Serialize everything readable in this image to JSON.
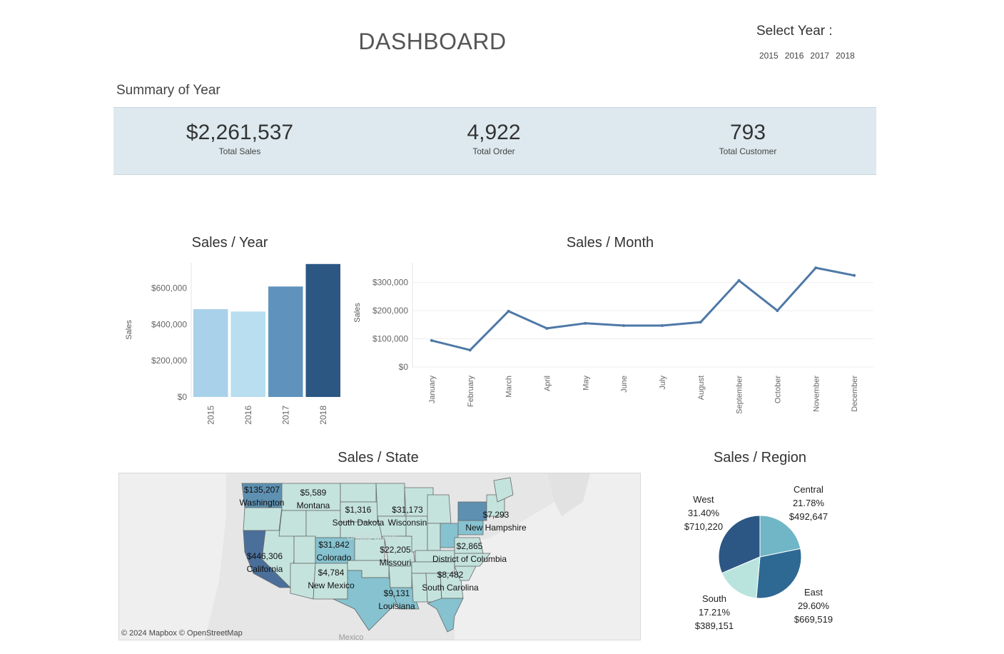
{
  "header": {
    "title": "DASHBOARD",
    "select_year_label": "Select Year :",
    "years": [
      "2015",
      "2016",
      "2017",
      "2018"
    ]
  },
  "summary": {
    "label": "Summary of Year",
    "kpis": [
      {
        "value": "$2,261,537",
        "label": "Total Sales"
      },
      {
        "value": "4,922",
        "label": "Total Order"
      },
      {
        "value": "793",
        "label": "Total Customer"
      }
    ]
  },
  "colors": {
    "kpi_band": "#dde9ef",
    "bar_2015": "#a9d1ea",
    "bar_2016": "#b8def0",
    "bar_2017": "#5f93be",
    "bar_2018": "#2b5782",
    "line": "#4e79a7",
    "map_light": "#c5e3dd",
    "map_mid": "#86c2cf",
    "map_dark": "#4a6f9a"
  },
  "chart_data": [
    {
      "type": "bar",
      "title": "Sales / Year",
      "xlabel": "",
      "ylabel": "Sales",
      "categories": [
        "2015",
        "2016",
        "2017",
        "2018"
      ],
      "values": [
        484000,
        471000,
        609000,
        733000
      ],
      "ylim": [
        0,
        740000
      ],
      "yticks": [
        0,
        200000,
        400000,
        600000
      ],
      "ytick_labels": [
        "$0",
        "$200,000",
        "$400,000",
        "$600,000"
      ],
      "grid": false
    },
    {
      "type": "line",
      "title": "Sales / Month",
      "xlabel": "",
      "ylabel": "Sales",
      "categories": [
        "January",
        "February",
        "March",
        "April",
        "May",
        "June",
        "July",
        "August",
        "September",
        "October",
        "November",
        "December"
      ],
      "values": [
        94000,
        60000,
        198000,
        137000,
        155000,
        147000,
        147000,
        159000,
        307000,
        200000,
        352000,
        325000
      ],
      "ylim": [
        0,
        370000
      ],
      "yticks": [
        0,
        100000,
        200000,
        300000
      ],
      "ytick_labels": [
        "$0",
        "$100,000",
        "$200,000",
        "$300,000"
      ],
      "grid": true
    },
    {
      "type": "pie",
      "title": "Sales / Region",
      "slices": [
        {
          "name": "Central",
          "percent": "21.78%",
          "value": 492647,
          "value_label": "$492,647",
          "color": "#70b6c6"
        },
        {
          "name": "East",
          "percent": "29.60%",
          "value": 669519,
          "value_label": "$669,519",
          "color": "#2e6993"
        },
        {
          "name": "South",
          "percent": "17.21%",
          "value": 389151,
          "value_label": "$389,151",
          "color": "#b9e4dd"
        },
        {
          "name": "West",
          "percent": "31.40%",
          "value": 710220,
          "value_label": "$710,220",
          "color": "#2c5785"
        }
      ]
    }
  ],
  "map": {
    "title": "Sales / State",
    "credit": "© 2024 Mapbox  © OpenStreetMap",
    "country_label": "United States",
    "mexico_label": "Mexico",
    "labels": [
      {
        "value": "$135,207",
        "state": "Washington"
      },
      {
        "value": "$5,589",
        "state": "Montana"
      },
      {
        "value": "$1,316",
        "state": "South Dakota"
      },
      {
        "value": "$31,173",
        "state": "Wisconsin"
      },
      {
        "value": "$7,293",
        "state": "New Hampshire"
      },
      {
        "value": "$446,306",
        "state": "California"
      },
      {
        "value": "$31,842",
        "state": "Colorado"
      },
      {
        "value": "$22,205",
        "state": "Missouri"
      },
      {
        "value": "$2,865",
        "state": "District of Columbia"
      },
      {
        "value": "$4,784",
        "state": "New Mexico"
      },
      {
        "value": "$8,482",
        "state": "South Carolina"
      },
      {
        "value": "$9,131",
        "state": "Louisiana"
      }
    ]
  }
}
